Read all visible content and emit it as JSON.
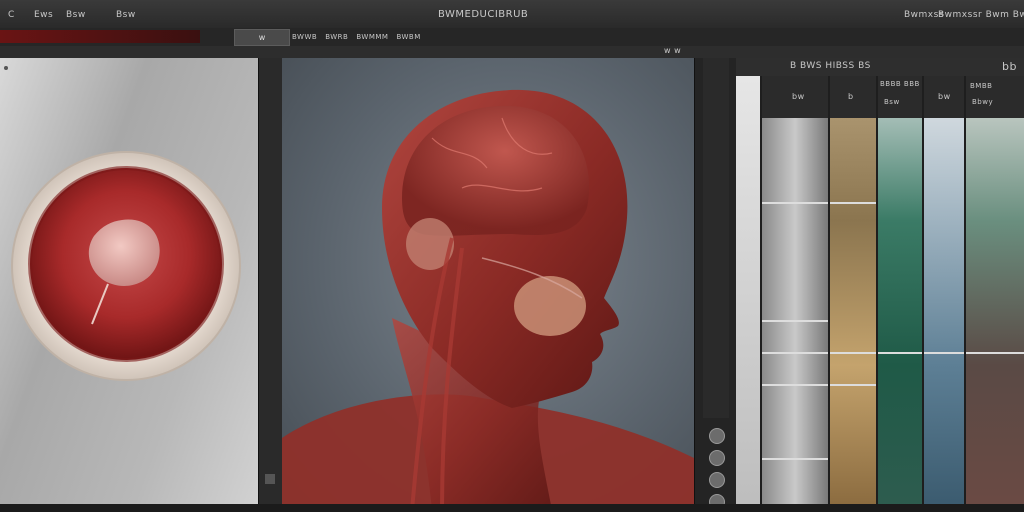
{
  "window": {
    "title": "BWMEDUCIBRUB",
    "title_right_left": "Bwmxss",
    "title_right_right": "Bwmxssr Bwm Bwww"
  },
  "toolbar": {
    "left_a": "C",
    "left_b": "Ews",
    "left_c": "Bsw",
    "mid_btn": "w",
    "mid_items": [
      "BWWB",
      "BWRB",
      "BWMMM",
      "BWBM"
    ],
    "far_right": "w w"
  },
  "right_panel": {
    "search_label": "B BWS HIBSS BS",
    "right_top": "bb",
    "columns": [
      {
        "head": "bw",
        "sub": ""
      },
      {
        "head": "b",
        "sub": ""
      },
      {
        "head": "BBBB BBB",
        "sub": "Bsw"
      },
      {
        "head": "bw",
        "sub": ""
      },
      {
        "head": "BMBB",
        "sub": "Bbwy"
      }
    ]
  },
  "colors": {
    "accent_red": "#8a1d1d",
    "panel_dark": "#1e1e1e",
    "viewport_bg": "#5a636c"
  },
  "icons": {
    "side_tool_1": "eye-icon",
    "side_tool_2": "brush-icon"
  }
}
